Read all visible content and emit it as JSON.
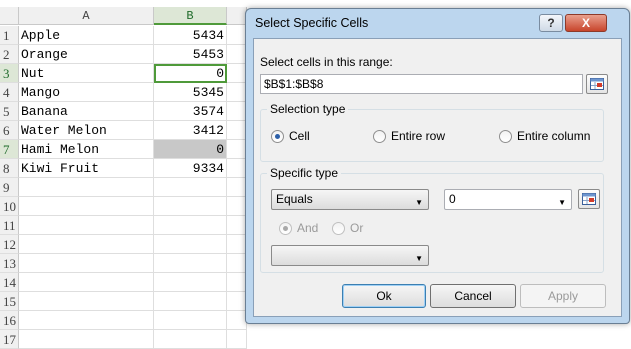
{
  "spreadsheet": {
    "columns": [
      "A",
      "B"
    ],
    "rows": [
      {
        "num": "1",
        "a": "Apple",
        "b": "5434"
      },
      {
        "num": "2",
        "a": "Orange",
        "b": "5453"
      },
      {
        "num": "3",
        "a": "Nut",
        "b": "0"
      },
      {
        "num": "4",
        "a": "Mango",
        "b": "5345"
      },
      {
        "num": "5",
        "a": "Banana",
        "b": "3574"
      },
      {
        "num": "6",
        "a": "Water Melon",
        "b": "3412"
      },
      {
        "num": "7",
        "a": "Hami Melon",
        "b": "0"
      },
      {
        "num": "8",
        "a": "Kiwi Fruit",
        "b": "9334"
      },
      {
        "num": "9",
        "a": "",
        "b": ""
      },
      {
        "num": "10",
        "a": "",
        "b": ""
      },
      {
        "num": "11",
        "a": "",
        "b": ""
      },
      {
        "num": "12",
        "a": "",
        "b": ""
      },
      {
        "num": "13",
        "a": "",
        "b": ""
      },
      {
        "num": "14",
        "a": "",
        "b": ""
      },
      {
        "num": "15",
        "a": "",
        "b": ""
      },
      {
        "num": "16",
        "a": "",
        "b": ""
      },
      {
        "num": "17",
        "a": "",
        "b": ""
      }
    ],
    "highlight_color": "#4f9a3a"
  },
  "dialog": {
    "title": "Select Specific Cells",
    "help_label": "?",
    "close_label": "X",
    "range_label": "Select cells in this range:",
    "range_value": "$B$1:$B$8",
    "selection_type": {
      "title": "Selection type",
      "options": [
        "Cell",
        "Entire row",
        "Entire column"
      ],
      "selected": "Cell"
    },
    "specific_type": {
      "title": "Specific type",
      "operator": "Equals",
      "value": "0",
      "and_label": "And",
      "or_label": "Or",
      "second_operator": ""
    },
    "buttons": {
      "ok": "Ok",
      "cancel": "Cancel",
      "apply": "Apply"
    }
  }
}
